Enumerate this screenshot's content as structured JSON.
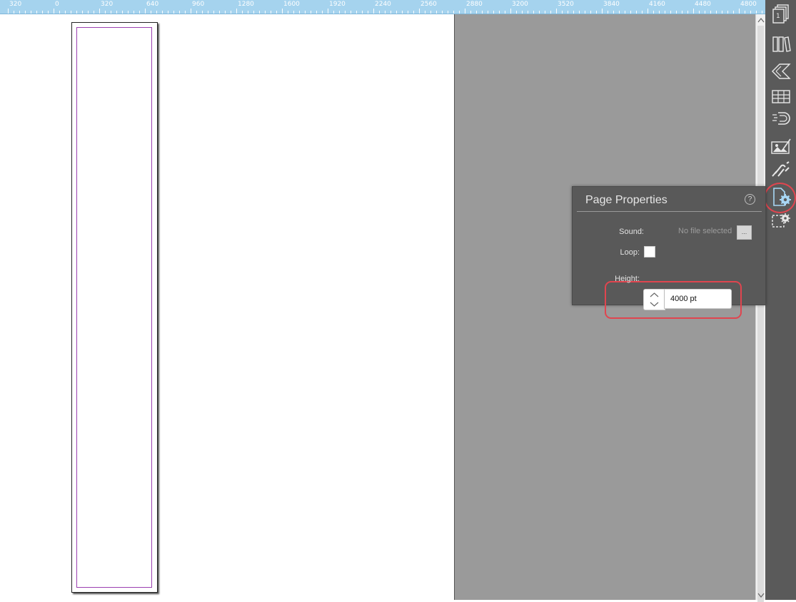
{
  "ruler": {
    "labels": [
      "320",
      "0",
      "320",
      "640",
      "960",
      "1280",
      "1600",
      "1920",
      "2240",
      "2560",
      "2880",
      "3200",
      "3520",
      "3840",
      "4160",
      "4480",
      "4800"
    ]
  },
  "sidebar": {
    "items": [
      {
        "icon": "pages-icon"
      },
      {
        "icon": "library-icon"
      },
      {
        "icon": "layers-icon"
      },
      {
        "icon": "table-icon"
      },
      {
        "icon": "magnet-icon"
      },
      {
        "icon": "image-properties-icon"
      },
      {
        "icon": "link-icon"
      },
      {
        "icon": "page-properties-icon",
        "active": true
      },
      {
        "icon": "object-properties-icon"
      }
    ]
  },
  "panel": {
    "title": "Page Properties",
    "help": "?",
    "sound_label": "Sound:",
    "sound_value": "No file selected",
    "browse_label": "...",
    "loop_label": "Loop:",
    "loop_checked": false,
    "height_label": "Height:",
    "height_value": "4000 pt"
  },
  "colors": {
    "ruler": "#a5d3ee",
    "sidebar": "#5a5a5a",
    "panel": "#595959",
    "highlight": "#e0454f",
    "margin_guide": "#9b3fb0"
  }
}
